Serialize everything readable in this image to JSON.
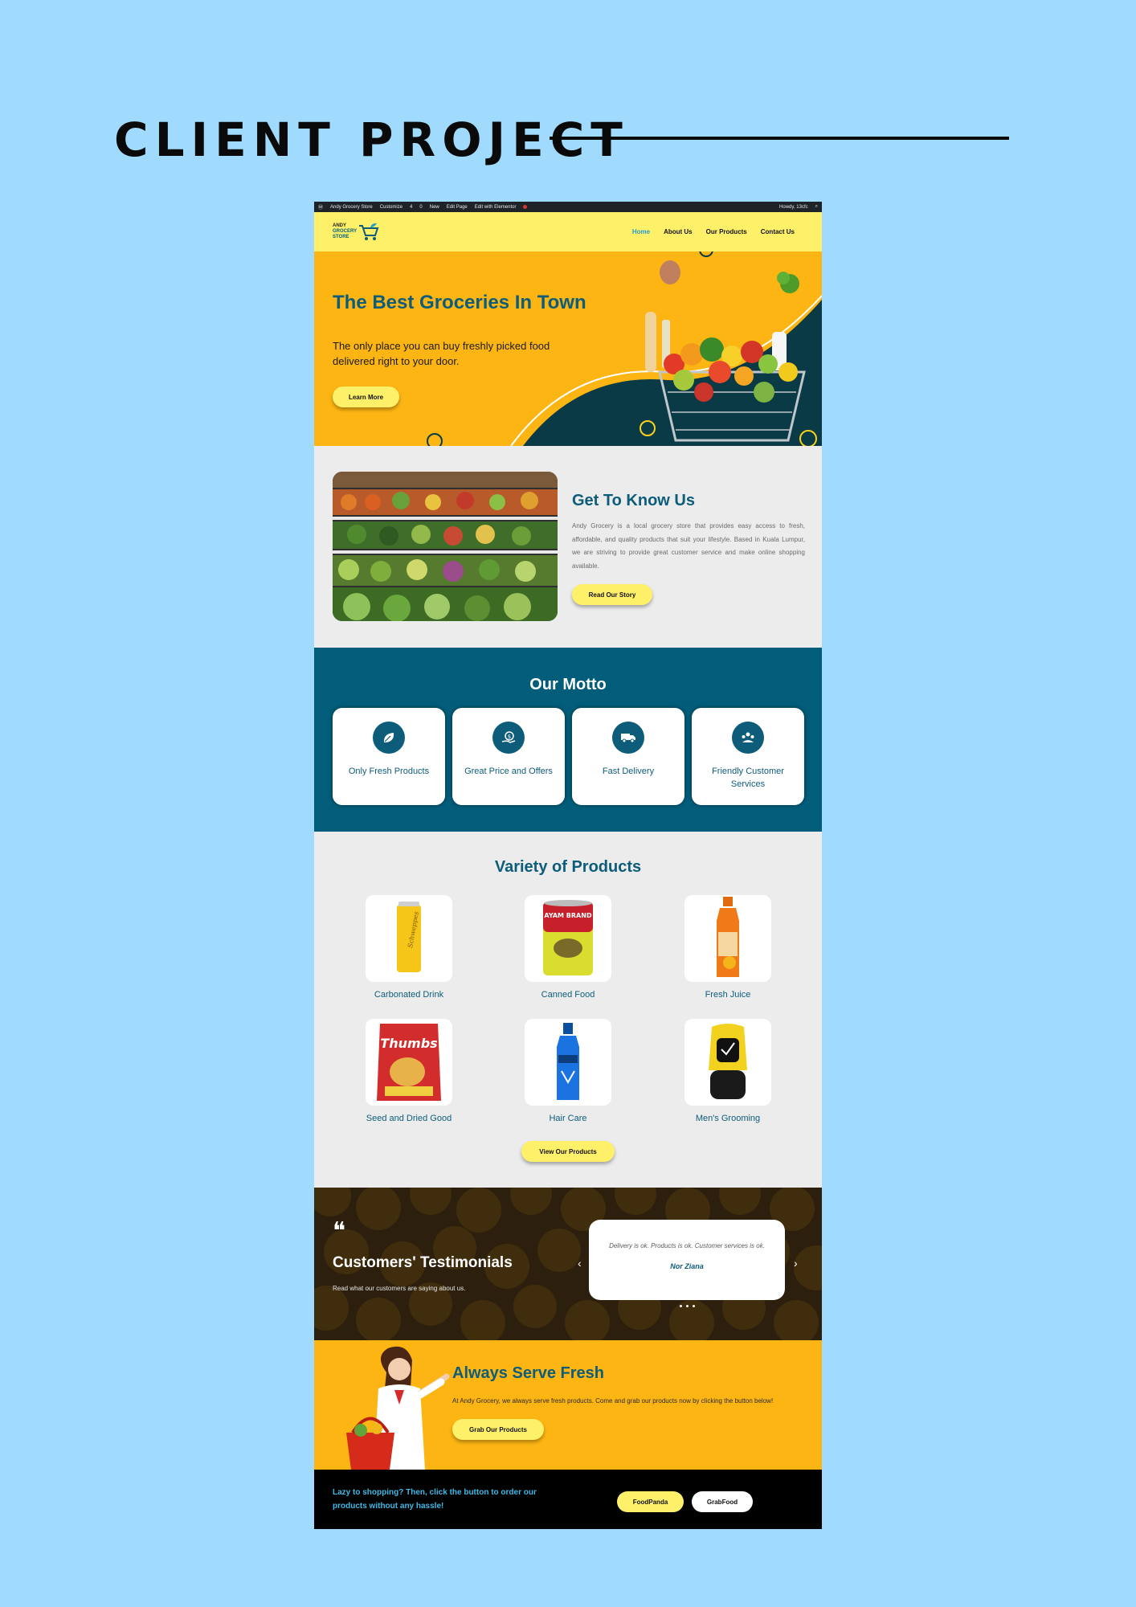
{
  "heading": "CLIENT PROJECT",
  "adminbar": {
    "items": [
      "Andy Grocery Store",
      "Customize",
      "4",
      "0",
      "New",
      "Edit Page",
      "Edit with Elementor"
    ],
    "howdy": "Howdy, 13cfc"
  },
  "brand": {
    "line1": "ANDY",
    "line2": "GROCERY",
    "line3": "STORE"
  },
  "nav": {
    "items": [
      "Home",
      "About Us",
      "Our Products",
      "Contact Us"
    ],
    "active": "Home"
  },
  "hero": {
    "title": "The Best Groceries In Town",
    "text": "The only place you can buy freshly picked food delivered right to your door.",
    "button": "Learn More"
  },
  "about": {
    "title": "Get To Know Us",
    "text": "Andy Grocery is a local grocery store that provides easy access to fresh, affordable, and quality products that suit your lifestyle. Based in Kuala Lumpur, we are striving to provide great customer service and make online shopping available.",
    "button": "Read Our Story"
  },
  "motto": {
    "title": "Our Motto",
    "cards": [
      {
        "label": "Only Fresh Products",
        "icon": "leaf-icon"
      },
      {
        "label": "Great Price and Offers",
        "icon": "price-tag-icon"
      },
      {
        "label": "Fast Delivery",
        "icon": "delivery-truck-icon"
      },
      {
        "label": "Friendly Customer Services",
        "icon": "customer-service-icon"
      }
    ]
  },
  "products": {
    "title": "Variety of Products",
    "items": [
      {
        "label": "Carbonated Drink"
      },
      {
        "label": "Canned Food"
      },
      {
        "label": "Fresh Juice"
      },
      {
        "label": "Seed and Dried Good"
      },
      {
        "label": "Hair Care"
      },
      {
        "label": "Men's Grooming"
      }
    ],
    "button": "View Our Products",
    "package_text": {
      "can": "Schweppes",
      "tin": "AYAM BRAND",
      "snack": "Thumbs"
    }
  },
  "testimonials": {
    "title": "Customers' Testimonials",
    "subtitle": "Read what our customers are saying about us.",
    "quote": "Delivery is ok. Products is ok. Customer services is ok.",
    "name": "Nor Ziana",
    "prev": "‹",
    "next": "›"
  },
  "serve": {
    "title": "Always Serve Fresh",
    "text": "At Andy Grocery, we always serve fresh products. Come and grab our products now by clicking the button below!",
    "button": "Grab Our Products"
  },
  "footer": {
    "text": "Lazy to shopping? Then, click the button to order our products without any hassle!",
    "foodpanda": "FoodPanda",
    "grabfood": "GrabFood"
  },
  "colors": {
    "brand_teal": "#015d7a",
    "accent_yellow": "#fff06a",
    "orange": "#fcb512",
    "link_blue": "#1f9ecd"
  }
}
